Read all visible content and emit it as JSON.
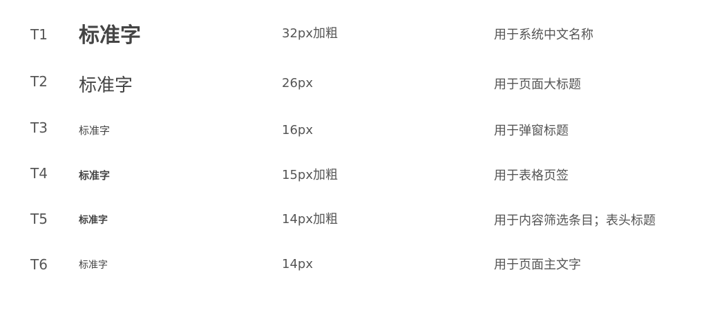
{
  "rows": [
    {
      "code": "T1",
      "sample": "标准字",
      "spec": "32px加粗",
      "usage": "用于系统中文名称"
    },
    {
      "code": "T2",
      "sample": "标准字",
      "spec": "26px",
      "usage": "用于页面大标题"
    },
    {
      "code": "T3",
      "sample": "标准字",
      "spec": "16px",
      "usage": "用于弹窗标题"
    },
    {
      "code": "T4",
      "sample": "标准字",
      "spec": "15px加粗",
      "usage": "用于表格页签"
    },
    {
      "code": "T5",
      "sample": "标准字",
      "spec": "14px加粗",
      "usage": "用于内容筛选条目；表头标题"
    },
    {
      "code": "T6",
      "sample": "标准字",
      "spec": "14px",
      "usage": "用于页面主文字"
    }
  ]
}
